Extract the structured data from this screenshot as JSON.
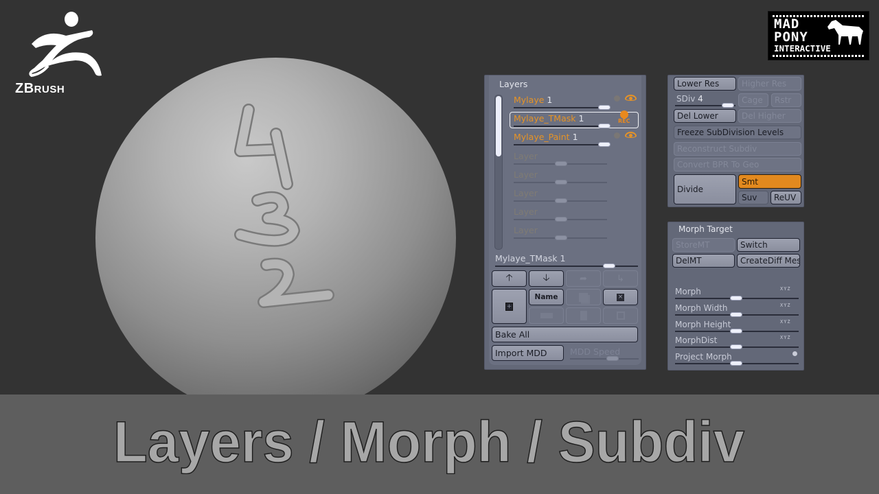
{
  "logos": {
    "zbrush": {
      "text_big": "ZB",
      "text_small": "RUSH",
      "icon": "zbrush-runner-icon"
    },
    "madpony": {
      "line1": "MAD",
      "line2": "PONY",
      "line3": "INTERACTIVE",
      "icon": "horse-icon"
    }
  },
  "title": "Layers / Morph / Subdiv",
  "viewport": {
    "sculpt_digits": [
      "4",
      "3",
      "2"
    ]
  },
  "layers_panel": {
    "header": "Layers",
    "layers": [
      {
        "name": "Mylaye",
        "value": "1",
        "active": true,
        "selected": false,
        "rec": false
      },
      {
        "name": "Mylaye_TMask",
        "value": "1",
        "active": true,
        "selected": true,
        "rec": true,
        "rec_label": "REC"
      },
      {
        "name": "Mylaye_Paint",
        "value": "1",
        "active": true,
        "selected": false,
        "rec": false
      },
      {
        "name": "Layer",
        "value": "",
        "active": false
      },
      {
        "name": "Layer",
        "value": "",
        "active": false
      },
      {
        "name": "Layer",
        "value": "",
        "active": false
      },
      {
        "name": "Layer",
        "value": "",
        "active": false
      },
      {
        "name": "Layer",
        "value": "",
        "active": false
      }
    ],
    "current_layer": {
      "name": "Mylaye_TMask",
      "value": "1"
    },
    "buttons": {
      "move_up": "move-up-icon",
      "move_down": "move-down-icon",
      "name": "Name",
      "bake_all": "Bake All",
      "import_mdd": "Import MDD",
      "mdd_speed": "MDD Speed"
    }
  },
  "subdiv_panel": {
    "lower_res": "Lower Res",
    "higher_res": "Higher Res",
    "sdiv_label": "SDiv",
    "sdiv_value": "4",
    "cage": "Cage",
    "rstr": "Rstr",
    "del_lower": "Del Lower",
    "del_higher": "Del Higher",
    "freeze": "Freeze SubDivision Levels",
    "reconstruct": "Reconstruct Subdiv",
    "convert_bpr": "Convert BPR To Geo",
    "divide": "Divide",
    "smt": "Smt",
    "suv": "Suv",
    "reuv": "ReUV"
  },
  "morph_panel": {
    "header": "Morph Target",
    "store_mt": "StoreMT",
    "switch": "Switch",
    "del_mt": "DelMT",
    "create_diff": "CreateDiff Mesh",
    "sliders": [
      {
        "label": "Morph",
        "xyz": "XYZ"
      },
      {
        "label": "Morph Width",
        "xyz": "XYZ"
      },
      {
        "label": "Morph Height",
        "xyz": "XYZ"
      },
      {
        "label": "MorphDist",
        "xyz": "XYZ"
      },
      {
        "label": "Project Morph",
        "xyz": ""
      }
    ]
  },
  "colors": {
    "accent": "#e2891e",
    "panel": "#6b7081",
    "background": "#333333"
  }
}
